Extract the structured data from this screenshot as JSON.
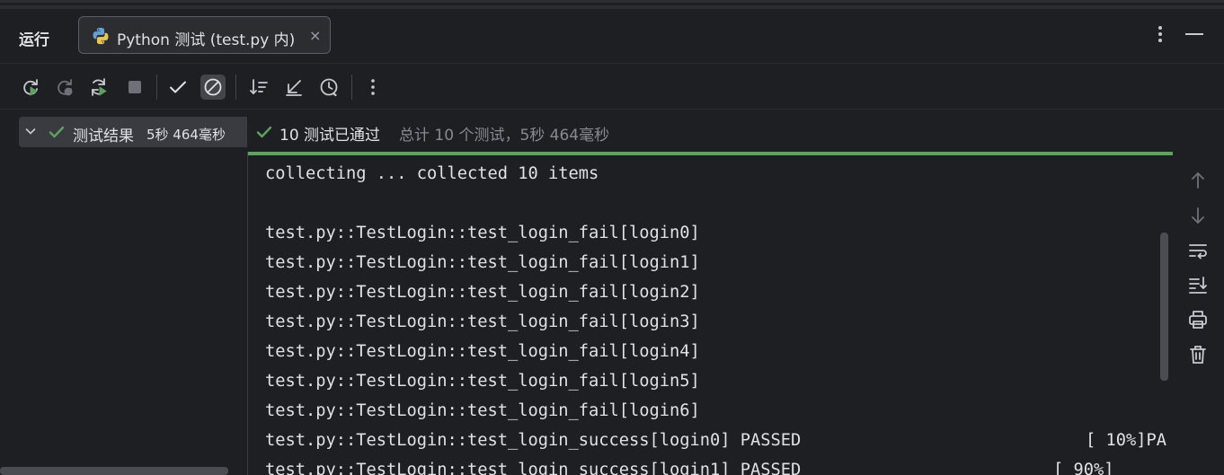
{
  "header": {
    "run_label": "运行",
    "tab_title": "Python 测试 (test.py 内)",
    "tab_close": "×"
  },
  "toolbar": {
    "icons": [
      "rerun-icon",
      "rerun-failed-icon",
      "toggle-auto-test-icon",
      "stop-icon",
      "show-passed-icon",
      "show-ignored-icon",
      "sort-icon",
      "collapse-icon",
      "history-icon",
      "more-icon"
    ]
  },
  "tree": {
    "root_label": "测试结果",
    "root_duration": "5秒 464毫秒"
  },
  "status": {
    "passed_text": "10 测试已通过",
    "summary_text": "总计 10 个测试，5秒 464毫秒"
  },
  "console": {
    "lines": [
      "collecting ... collected 10 items",
      "",
      "test.py::TestLogin::test_login_fail[login0]",
      "test.py::TestLogin::test_login_fail[login1]",
      "test.py::TestLogin::test_login_fail[login2]",
      "test.py::TestLogin::test_login_fail[login3]",
      "test.py::TestLogin::test_login_fail[login4]",
      "test.py::TestLogin::test_login_fail[login5]",
      "test.py::TestLogin::test_login_fail[login6]",
      "test.py::TestLogin::test_login_success[login0] PASSED",
      "test.py::TestLogin::test_login_success[login1] PASSED"
    ],
    "pct_row9": "[ 10%]PA",
    "pct_row10": "[ 90%]"
  },
  "colors": {
    "background": "#1e1f22",
    "success_green": "#5fa25f",
    "text": "#dfe1e5",
    "muted": "#868a91"
  }
}
